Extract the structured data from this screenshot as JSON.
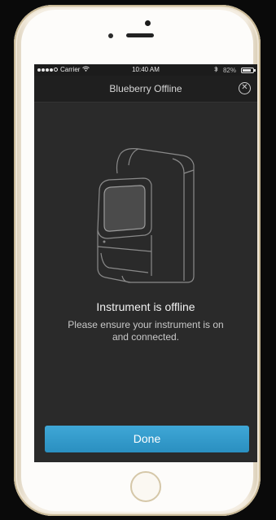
{
  "status_bar": {
    "carrier": "Carrier",
    "time": "10:40 AM",
    "battery_percent": "82%",
    "battery_level": 0.82,
    "signal_bars_filled": 4,
    "signal_bars_total": 5
  },
  "nav": {
    "title": "Blueberry Offline",
    "close_icon": "close-circle-icon"
  },
  "illustration": {
    "icon": "instrument-device-icon"
  },
  "message": {
    "title": "Instrument is offline",
    "body": "Please ensure your instrument is on and connected."
  },
  "actions": {
    "done_label": "Done"
  },
  "colors": {
    "accent": "#2f98c8",
    "screen_bg": "#2a2a2a",
    "nav_bg": "#1f1f1f"
  }
}
